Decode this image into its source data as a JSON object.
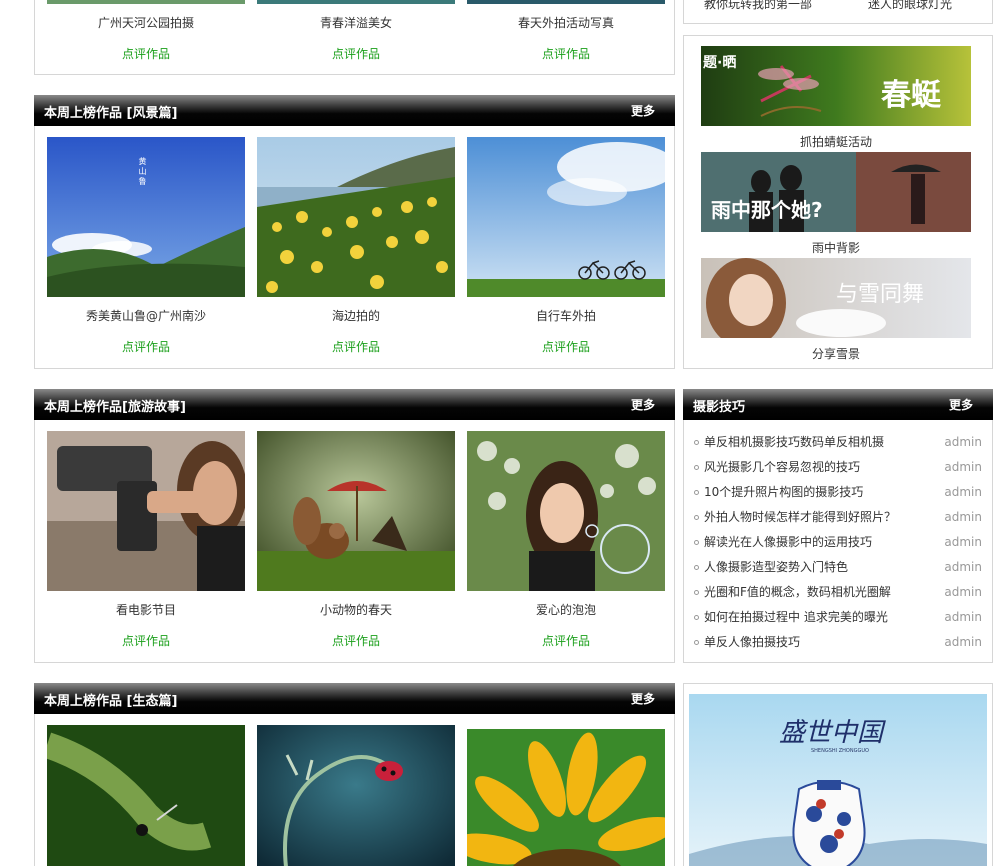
{
  "top_gallery": {
    "items": [
      {
        "caption": "广州天河公园拍摄",
        "rate": "点评作品"
      },
      {
        "caption": "青春洋溢美女",
        "rate": "点评作品"
      },
      {
        "caption": "春天外拍活动写真",
        "rate": "点评作品"
      }
    ]
  },
  "top_right": {
    "left_text": "教你玩转我的第一部",
    "right_text": "迷人的眼球灯光"
  },
  "scenery": {
    "title": "本周上榜作品 [风景篇]",
    "more": "更多",
    "items": [
      {
        "caption": "秀美黄山鲁@广州南沙",
        "rate": "点评作品",
        "overlay_text": "黄山鲁"
      },
      {
        "caption": "海边拍的",
        "rate": "点评作品"
      },
      {
        "caption": "自行车外拍",
        "rate": "点评作品"
      }
    ]
  },
  "activities": {
    "items": [
      {
        "caption": "抓拍蜻蜓活动",
        "banner_tag": "题·晒",
        "banner_text": "春蜓"
      },
      {
        "caption": "雨中背影",
        "banner_text": "雨中那个她?"
      },
      {
        "caption": "分享雪景",
        "banner_text": "与雪同舞"
      }
    ]
  },
  "travel": {
    "title": "本周上榜作品[旅游故事]",
    "more": "更多",
    "items": [
      {
        "caption": "看电影节目",
        "rate": "点评作品"
      },
      {
        "caption": "小动物的春天",
        "rate": "点评作品"
      },
      {
        "caption": "爱心的泡泡",
        "rate": "点评作品"
      }
    ]
  },
  "tips": {
    "title": "摄影技巧",
    "more": "更多",
    "items": [
      {
        "title": "单反相机摄影技巧数码单反相机摄",
        "author": "admin"
      },
      {
        "title": "风光摄影几个容易忽视的技巧",
        "author": "admin"
      },
      {
        "title": "10个提升照片构图的摄影技巧",
        "author": "admin"
      },
      {
        "title": "外拍人物时候怎样才能得到好照片？",
        "author": "admin"
      },
      {
        "title": "解读光在人像摄影中的运用技巧",
        "author": "admin"
      },
      {
        "title": "人像摄影造型姿势入门特色",
        "author": "admin"
      },
      {
        "title": "光圈和F值的概念，数码相机光圈解",
        "author": "admin"
      },
      {
        "title": "如何在拍摄过程中 追求完美的曝光",
        "author": "admin"
      },
      {
        "title": "单反人像拍摄技巧",
        "author": "admin"
      }
    ]
  },
  "ecology": {
    "title": "本周上榜作品 [生态篇]",
    "more": "更多"
  },
  "ad": {
    "title": "盛世中国",
    "subtitle": "SHENGSHI ZHONGGUO"
  }
}
